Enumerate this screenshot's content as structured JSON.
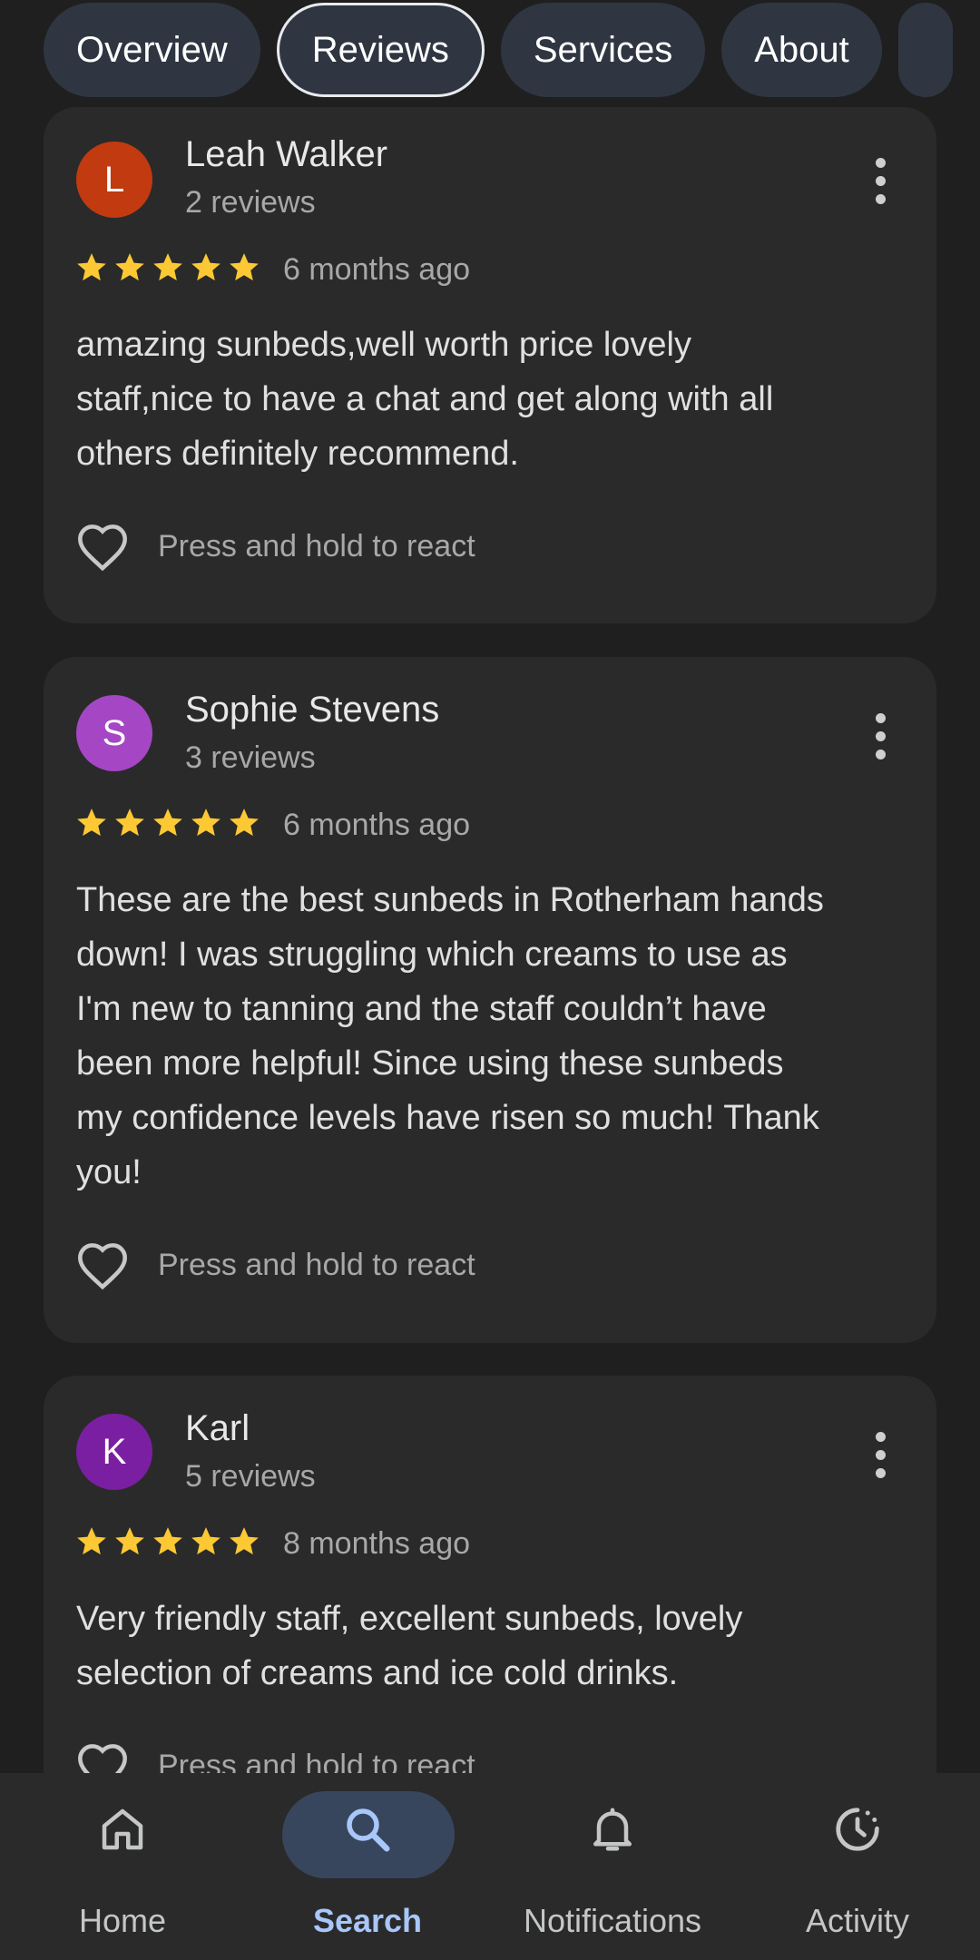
{
  "tabs": [
    {
      "label": "Overview"
    },
    {
      "label": "Reviews"
    },
    {
      "label": "Services"
    },
    {
      "label": "About"
    }
  ],
  "reviews": [
    {
      "initial": "L",
      "avatar_color": "#c13a10",
      "name": "Leah Walker",
      "review_count": "2 reviews",
      "rating": 5,
      "time": "6 months ago",
      "text_lines": [
        "amazing sunbeds,well worth price lovely",
        "staff,nice to have a chat and get along with all",
        "others definitely recommend."
      ],
      "react_label": "Press and hold to react"
    },
    {
      "initial": "S",
      "avatar_color": "#a546c4",
      "name": "Sophie Stevens",
      "review_count": "3 reviews",
      "rating": 5,
      "time": "6 months ago",
      "text_lines": [
        "These are the best sunbeds in Rotherham hands",
        "down! I was struggling which creams to use as",
        "I'm new to tanning and the staff couldn’t have",
        "been more helpful! Since using these sunbeds",
        "my confidence levels have risen so much! Thank",
        "you!"
      ],
      "react_label": "Press and hold to react"
    },
    {
      "initial": "K",
      "avatar_color": "#7b1fa2",
      "name": "Karl",
      "review_count": "5 reviews",
      "rating": 5,
      "time": "8 months ago",
      "text_lines": [
        "Very friendly staff, excellent sunbeds, lovely",
        "selection of creams and ice cold drinks."
      ],
      "react_label": "Press and hold to react"
    }
  ],
  "bottom_nav": {
    "home": "Home",
    "search": "Search",
    "notifications": "Notifications",
    "activity": "Activity"
  },
  "colors": {
    "star": "#fcc934",
    "active_nav": "#a8c7fa"
  }
}
